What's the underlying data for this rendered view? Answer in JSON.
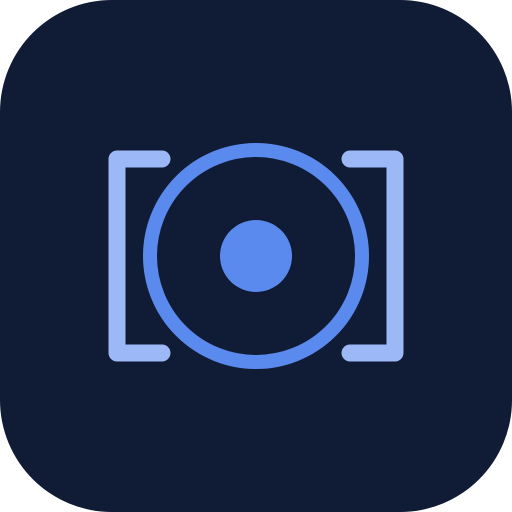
{
  "app_icon": {
    "name": "app-icon",
    "glyphs": [
      "left-bracket-icon",
      "ring-icon",
      "center-dot-icon",
      "right-bracket-icon"
    ],
    "colors": {
      "background": "#101B35",
      "bracket": "#9DB8F6",
      "ring": "#5B8AEE",
      "dot": "#5B8AEE"
    }
  }
}
